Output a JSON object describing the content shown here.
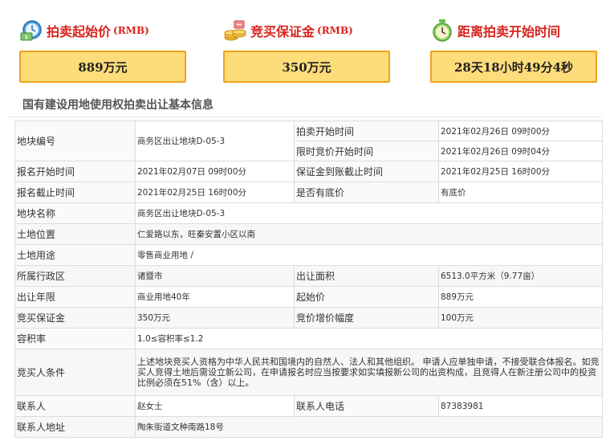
{
  "summary": {
    "start_price": {
      "title": "拍卖起始价",
      "unit": "(RMB)",
      "value": "889万元",
      "icon": "money-clock-icon"
    },
    "deposit": {
      "title": "竞买保证金",
      "unit": "(RMB)",
      "value": "350万元",
      "icon": "coins-icon"
    },
    "countdown": {
      "title": "距离拍卖开始时间",
      "value": "28天18小时49分4秒",
      "icon": "alarm-clock-icon"
    }
  },
  "section_title": "国有建设用地使用权拍卖出让基本信息",
  "info": {
    "parcel_no_label": "地块编号",
    "parcel_no": "商务区出让地块D-05-3",
    "auction_start_label": "拍卖开始时间",
    "auction_start": "2021年02月26日 09时00分",
    "timed_bid_label": "限时竞价开始时间",
    "timed_bid": "2021年02月26日 09时04分",
    "reg_start_label": "报名开始时间",
    "reg_start": "2021年02月07日 09时00分",
    "deposit_deadline_label": "保证金到账截止时间",
    "deposit_deadline": "2021年02月25日 16时00分",
    "reg_end_label": "报名截止时间",
    "reg_end": "2021年02月25日 16时00分",
    "reserve_label": "是否有底价",
    "reserve": "有底价",
    "parcel_name_label": "地块名称",
    "parcel_name": "商务区出让地块D-05-3",
    "location_label": "土地位置",
    "location": "仁爱路以东，旺秦安置小区以南",
    "usage_label": "土地用途",
    "usage": "零售商业用地 /",
    "district_label": "所属行政区",
    "district": "诸暨市",
    "area_label": "出让面积",
    "area": "6513.0平方米（9.77亩）",
    "term_label": "出让年限",
    "term": "商业用地40年",
    "start_price_label": "起始价",
    "start_price": "889万元",
    "bid_deposit_label": "竞买保证金",
    "bid_deposit": "350万元",
    "increment_label": "竞价增价幅度",
    "increment": "100万元",
    "plot_ratio_label": "容积率",
    "plot_ratio": "1.0≤容积率≤1.2",
    "conditions_label": "竞买人条件",
    "conditions": "上述地块竞买人资格为中华人民共和国境内的自然人、法人和其他组织。 申请人应单独申请，不接受联合体报名。如竞买人竞得土地后需设立新公司，在申请报名时应当按要求如实填报新公司的出资构成，且竞得人在新注册公司中的投资比例必须在51%（含）以上。",
    "contact_label": "联系人",
    "contact": "赵女士",
    "phone_label": "联系人电话",
    "phone": "87383981",
    "address_label": "联系人地址",
    "address": "陶朱街道文种南路18号"
  }
}
